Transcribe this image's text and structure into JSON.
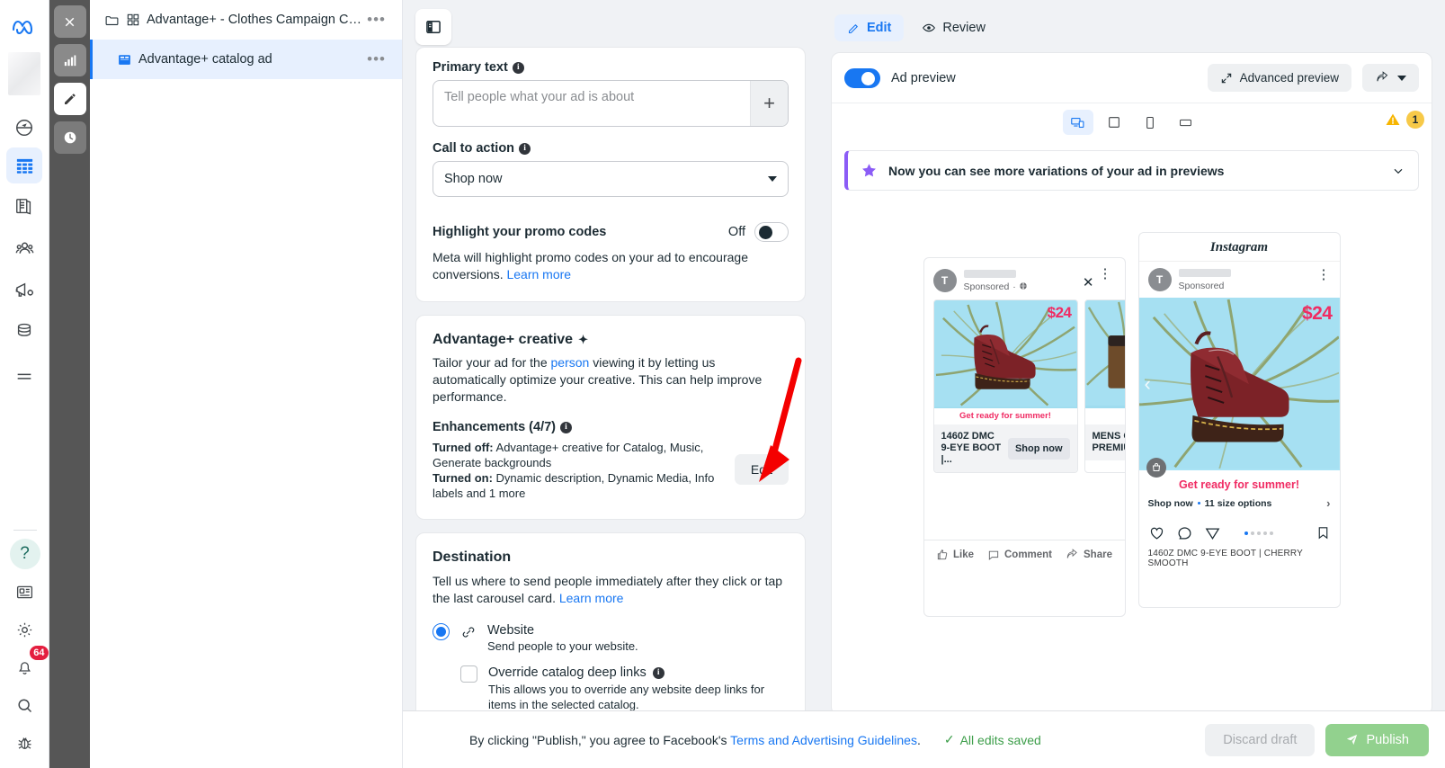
{
  "rail": {
    "logo": "meta-logo",
    "items": [
      {
        "name": "dashboard-icon",
        "label": "Dashboard"
      },
      {
        "name": "table-icon",
        "label": "Campaigns",
        "active": true
      },
      {
        "name": "pages-icon",
        "label": "Pages"
      },
      {
        "name": "audiences-icon",
        "label": "Audiences"
      },
      {
        "name": "ads-icon",
        "label": "Ads"
      },
      {
        "name": "billing-icon",
        "label": "Billing"
      },
      {
        "name": "menu-icon",
        "label": "All tools"
      }
    ],
    "bottom": [
      {
        "name": "help-icon",
        "label": "Help",
        "glyph": "?"
      },
      {
        "name": "news-icon",
        "label": "News"
      },
      {
        "name": "gear-icon",
        "label": "Settings"
      },
      {
        "name": "bell-icon",
        "label": "Notifications",
        "badge": "64"
      },
      {
        "name": "search-icon",
        "label": "Search"
      },
      {
        "name": "bug-icon",
        "label": "Report a bug"
      }
    ]
  },
  "darkstrip": {
    "buttons": [
      {
        "name": "close-button",
        "icon": "close-icon"
      },
      {
        "name": "chart-button",
        "icon": "bar-chart-icon"
      },
      {
        "name": "edit-button",
        "icon": "pencil-icon",
        "active": true
      },
      {
        "name": "history-button",
        "icon": "clock-icon"
      }
    ]
  },
  "tree": {
    "rows": [
      {
        "label": "Advantage+ - Clothes Campaign Ca...",
        "icon": "folder-icon",
        "selected": false
      },
      {
        "label": "Advantage+ catalog ad",
        "icon": "ad-icon",
        "selected": true
      }
    ],
    "menu_glyph": "•••"
  },
  "form": {
    "panel_toggle": "sidebar-toggle-icon",
    "primary_text": {
      "label": "Primary text",
      "placeholder": "Tell people what your ad is about",
      "value": "",
      "add_glyph": "+"
    },
    "call_to_action": {
      "label": "Call to action",
      "value": "Shop now"
    },
    "promo": {
      "label": "Highlight your promo codes",
      "state": "Off",
      "description": "Meta will highlight promo codes on your ad to encourage conversions.",
      "link": "Learn more"
    },
    "advantage": {
      "title": "Advantage+ creative",
      "sparkle": "✦",
      "desc_a": "Tailor your ad for the ",
      "desc_link": "person",
      "desc_b": " viewing it by letting us automatically optimize your creative. This can help improve performance.",
      "enhancements_label": "Enhancements (4/7)",
      "turned_off_label": "Turned off:",
      "turned_off_value": " Advantage+ creative for Catalog, Music, Generate backgrounds",
      "turned_on_label": "Turned on:",
      "turned_on_value": " Dynamic description, Dynamic Media, Info labels and 1 more",
      "edit_button": "Edit"
    },
    "destination": {
      "title": "Destination",
      "desc": "Tell us where to send people immediately after they click or tap the last carousel card. ",
      "link": "Learn more",
      "option_website": "Website",
      "option_website_sub": "Send people to your website.",
      "override_label": "Override catalog deep links",
      "override_sub": "This allows you to override any website deep links for items in the selected catalog."
    }
  },
  "preview": {
    "tabs": [
      {
        "label": "Edit",
        "icon": "pencil-icon",
        "active": true
      },
      {
        "label": "Review",
        "icon": "eye-icon",
        "active": false
      }
    ],
    "ad_preview_label": "Ad preview",
    "advanced_preview": "Advanced preview",
    "share_icon": "share-icon",
    "devices": [
      {
        "name": "desktop-mobile-icon",
        "active": true
      },
      {
        "name": "square-icon",
        "active": false
      },
      {
        "name": "phone-icon",
        "active": false
      },
      {
        "name": "landscape-icon",
        "active": false
      }
    ],
    "warning_count": "1",
    "banner": {
      "icon": "star-icon",
      "text": "Now you can see more variations of your ad in previews",
      "chevron": "chevron-down-icon"
    },
    "facebook": {
      "avatar_initial": "T",
      "sponsored": "Sponsored",
      "close_glyph": "✕",
      "dots_glyph": "⋮",
      "cards": [
        {
          "price": "$24",
          "overlay": "Get ready for summer!",
          "title": "1460Z DMC 9-EYE BOOT |...",
          "cta": "Shop now"
        },
        {
          "price": "$",
          "title": "MENS C... PREMIU..."
        }
      ],
      "actions": [
        {
          "label": "Like",
          "icon": "thumbs-up-icon"
        },
        {
          "label": "Comment",
          "icon": "comment-icon"
        },
        {
          "label": "Share",
          "icon": "share-icon"
        }
      ]
    },
    "instagram": {
      "brand": "Instagram",
      "avatar_initial": "T",
      "sponsored": "Sponsored",
      "dots_glyph": "⋮",
      "price": "$24",
      "overlay": "Get ready for summer!",
      "cta": "Shop now",
      "size_options": "11 size options",
      "caption": "1460Z DMC 9-EYE BOOT | CHERRY SMOOTH",
      "icons": [
        {
          "name": "heart-icon"
        },
        {
          "name": "comment-icon"
        },
        {
          "name": "send-icon"
        },
        {
          "name": "bookmark-icon"
        }
      ],
      "page_dots": 5,
      "active_dot": 0
    }
  },
  "bottombar": {
    "legal_a": "By clicking \"Publish,\" you agree to Facebook's ",
    "legal_link": "Terms and Advertising Guidelines",
    "legal_b": ".",
    "saved": "All edits saved",
    "check": "✓",
    "discard": "Discard draft",
    "publish": "Publish"
  },
  "colors": {
    "accent": "#1877f2",
    "banner_accent": "#8b5cf6",
    "warning": "#f7c948",
    "price": "#f02b63",
    "publish": "#92d18e",
    "saved": "#3d9e4a",
    "annotation_arrow": "#f40000"
  }
}
